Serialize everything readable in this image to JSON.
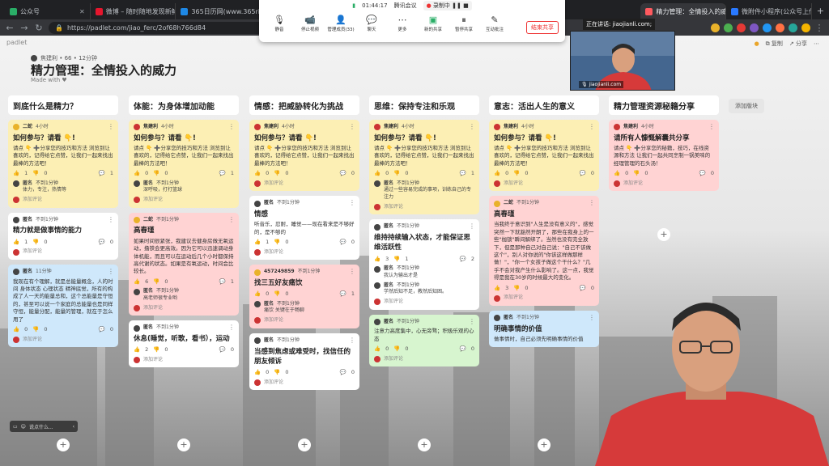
{
  "tabs": [
    {
      "label": "公众号",
      "color": "#2aae67"
    },
    {
      "label": "微博 – 随时随地发现新鲜事",
      "color": "#e6162d"
    },
    {
      "label": "365日历网(www.365rili.com)",
      "color": "#1e88e5"
    },
    {
      "label": "精力管理：全情投入的威力",
      "color": "#ff5a5f"
    },
    {
      "label": "微附件小程序(公众号上传附件)",
      "color": "#2979ff"
    }
  ],
  "address": {
    "url": "https://padlet.com/jiao_ferc/2of68h766d84"
  },
  "meeting": {
    "time": "01:44:17",
    "app": "腾讯会议",
    "recording": "录制中",
    "buttons": [
      "静音",
      "停止视频",
      "管理成员(33)",
      "聊天",
      "更多",
      "新的共享",
      "暂停共享",
      "互动批注"
    ],
    "end_share": "结束共享",
    "speaking": "正在讲话: jiaojianli.com;"
  },
  "camera": {
    "name": "jiaojianli.com"
  },
  "padlet": {
    "logo": "padlet",
    "author": "焦建利 • 66 • 12分钟",
    "title": "精力管理：全情投入的威力",
    "made_with": "Made with ♥",
    "actions": [
      "复制",
      "分享"
    ],
    "add_block": "添加版块"
  },
  "columns": [
    {
      "title": "到底什么是精力？",
      "posts": [
        {
          "color": "yellow",
          "author": "二蛇",
          "time": "4小时",
          "title": "如何参与？请看 👇!",
          "body": "请点 👇 ➕分享您的技巧和方法 浏览到让喜欢的，记得给它点赞，让我们一起来找出最棒的方法吧！",
          "likes": "1",
          "dislikes": "0",
          "comments": "1",
          "comment_author": "匿名",
          "comment_time": "不到1分钟",
          "comment_text": "体力，专注，热情等",
          "add": "添加评论"
        },
        {
          "color": "white",
          "author": "匿名",
          "time": "不到1分钟",
          "title": "精力就是做事情的能力",
          "body": "",
          "likes": "1",
          "dislikes": "0",
          "comments": "0",
          "add": "添加评论"
        },
        {
          "color": "blue",
          "author": "匿名",
          "time": "11分钟",
          "title": "",
          "body": "我现在有个理解，就是总能量概念，人的时间 身体状态 心理状态 精神底觉，所有的构成了人一天的能量总和，这个总能量是守恒的，甚至可以说一个家庭的总能量也是同样守恒，能量分配，能量的管理，就在于怎么用了",
          "likes": "0",
          "dislikes": "0",
          "comments": "0",
          "add": "添加评论"
        }
      ]
    },
    {
      "title": "体能：为身体增加动能",
      "posts": [
        {
          "color": "yellow",
          "author": "焦建利",
          "time": "4小时",
          "title": "如何参与？请看 👇!",
          "body": "请点 👇 ➕分享您的技巧和方法 浏览到让喜欢的，记得给它点赞，让我们一起来找出最棒的方法吧！",
          "likes": "0",
          "dislikes": "0",
          "comments": "1",
          "comment_author": "匿名",
          "comment_time": "不到1分钟",
          "comment_text": "深呼吸，打打篮球",
          "add": "添加评论"
        },
        {
          "color": "pink",
          "author": "二蛇",
          "time": "不到1分钟",
          "title": "高春瑾",
          "body": "如果时间很紧张，我建议去健身房做无氧运动，撸铁会更高效。因为它可以迅速调动身体机能，而且可以在运动后几个小时都保持高代谢的状态。如果是有氧运动，时间会比较长。",
          "likes": "6",
          "dislikes": "0",
          "comments": "1",
          "comment_author": "匿名",
          "comment_time": "不到1分钟",
          "comment_text": "高老师很专业哟",
          "add": "添加评论"
        },
        {
          "color": "white",
          "author": "匿名",
          "time": "不到1分钟",
          "title": "休息(睡觉，听歌，看书），运动",
          "body": "",
          "likes": "2",
          "dislikes": "0",
          "comments": "0",
          "add": "添加评论"
        }
      ]
    },
    {
      "title": "情感：把威胁转化为挑战",
      "posts": [
        {
          "color": "yellow",
          "author": "焦建利",
          "time": "4小时",
          "title": "如何参与？请看 👇!",
          "body": "请点 👇 ➕分享您的技巧和方法 浏览到让喜欢的，记得给它点赞，让我们一起来找出最棒的方法吧！",
          "likes": "0",
          "dislikes": "0",
          "comments": "0",
          "add": "添加评论"
        },
        {
          "color": "white",
          "author": "匿名",
          "time": "不到1分钟",
          "title": "情感",
          "body": "听音乐，忍耐，睡觉——现在看来是不够好的，是不够的",
          "likes": "1",
          "dislikes": "0",
          "comments": "0",
          "add": "添加评论"
        },
        {
          "color": "pink",
          "author": "457249859",
          "time": "不到1分钟",
          "title": "找三五好友痛饮",
          "body": "",
          "likes": "0",
          "dislikes": "0",
          "comments": "1",
          "comment_author": "匿名",
          "comment_time": "不到1分钟",
          "comment_text": "痛饮 关键在于畅聊",
          "add": "添加评论"
        },
        {
          "color": "white",
          "author": "匿名",
          "time": "不到1分钟",
          "title": "当感到焦虑或难受时，找信任的朋友倾诉",
          "body": "",
          "likes": "0",
          "dislikes": "0",
          "comments": "0",
          "add": "添加评论"
        }
      ]
    },
    {
      "title": "思维：保持专注和乐观",
      "posts": [
        {
          "color": "yellow",
          "author": "焦建利",
          "time": "4小时",
          "title": "如何参与？请看 👇!",
          "body": "请点 👇 ➕分享您的技巧和方法 浏览到让喜欢的，记得给它点赞，让我们一起来找出最棒的方法吧！",
          "likes": "0",
          "dislikes": "0",
          "comments": "1",
          "comment_author": "匿名",
          "comment_time": "不到1分钟",
          "comment_text": "通过一些容易完成的事项，训练自己的专注力",
          "add": "添加评论"
        },
        {
          "color": "white",
          "author": "匿名",
          "time": "不到1分钟",
          "title": "维持持续输入状态，才能保证思维活跃性",
          "body": "",
          "likes": "3",
          "dislikes": "1",
          "comments": "2",
          "comment_author": "匿名",
          "comment_time": "不到1分钟",
          "comment_text": "我认为输出才是",
          "comment2_author": "匿名",
          "comment2_time": "不到1分钟",
          "comment2_text": "学然后知不足，教然后知困。",
          "add": "添加评论"
        },
        {
          "color": "green",
          "author": "匿名",
          "time": "不到1分钟",
          "title": "",
          "body": "注意力高度集中，心无旁骛；积极乐观的心态",
          "likes": "0",
          "dislikes": "0",
          "comments": "0",
          "add": "添加评论"
        }
      ]
    },
    {
      "title": "意志：活出人生的意义",
      "posts": [
        {
          "color": "yellow",
          "author": "焦建利",
          "time": "4小时",
          "title": "如何参与？请看 👇!",
          "body": "请点 👇 ➕分享您的技巧和方法 浏览到让喜欢的，记得给它点赞，让我们一起来找出最棒的方法吧！",
          "likes": "0",
          "dislikes": "0",
          "comments": "0",
          "add": "添加评论"
        },
        {
          "color": "pink",
          "author": "二蛇",
          "time": "不到1分钟",
          "title": "高春瑾",
          "body": "当我终于意识到\"人生是没有意义的\"，感觉突然一下就豁然开朗了，那些在我身上的一些\"枷锁\"瞬间解绑了。当然也没有完全放下，但是那种自己对自己说：\"自己不该做这个\"，别人对你说的\"你该这样做那样做！\"，\"你一个女孩子做这个干什么？\"几乎不会对我产生什么影响了。这一点，我觉得是我在30岁的时候最大的变化。",
          "likes": "3",
          "dislikes": "0",
          "comments": "0",
          "add": "添加评论"
        },
        {
          "color": "blue",
          "author": "匿名",
          "time": "不到1分钟",
          "title": "明确事情的价值",
          "body": "做事情时，自己必须先明确事情的价值",
          "likes": "",
          "dislikes": "",
          "comments": "",
          "add": ""
        }
      ]
    },
    {
      "title": "精力管理资源秘籍分享",
      "posts": [
        {
          "color": "pink",
          "author": "焦建利",
          "time": "4小时",
          "title": "请所有人慷慨解囊共分享",
          "body": "请点 👇 ➕分享您的秘籍，技巧，在线资源和方法 让我们一起共同烹制一锅美味的经理管理的石头汤！",
          "likes": "0",
          "dislikes": "0",
          "comments": "0",
          "add": "添加评论"
        }
      ]
    }
  ],
  "chat": {
    "placeholder": "说点什么..."
  }
}
